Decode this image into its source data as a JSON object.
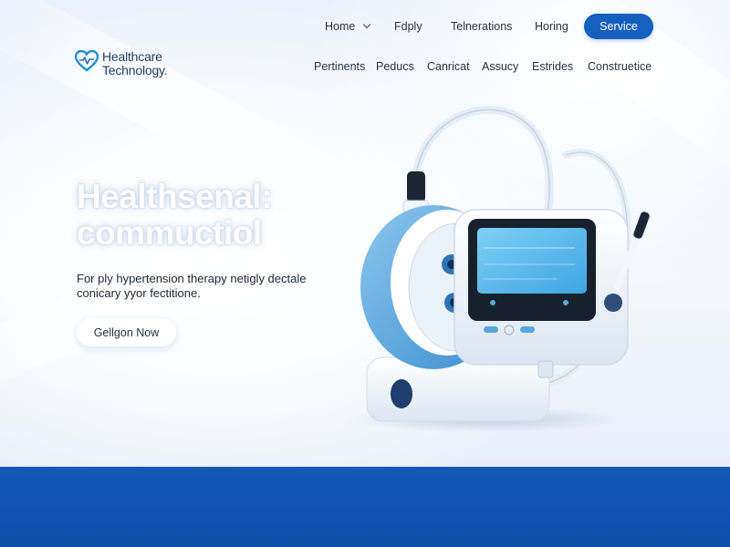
{
  "brand": {
    "line1": "Healthcare",
    "line2": "Technology."
  },
  "nav": {
    "top": [
      {
        "label": "Home"
      },
      {
        "label": "Fdply"
      },
      {
        "label": "Telnerations"
      },
      {
        "label": "Horing"
      }
    ],
    "service_button": "Service",
    "bottom": [
      {
        "label": "Pertinents"
      },
      {
        "label": "Peducs"
      },
      {
        "label": "Canricat"
      },
      {
        "label": "Assucy"
      },
      {
        "label": "Estrides"
      },
      {
        "label": "Construetice"
      }
    ]
  },
  "hero": {
    "headline_line1": "Healthsenal:",
    "headline_line2": "commuctiol",
    "subtext_line1": "For ply hypertension therapy netigly dectale",
    "subtext_line2": "conicary yyor fectitione.",
    "cta_label": "Gellgon Now"
  },
  "colors": {
    "brand_blue": "#1560bd",
    "footer_blue": "#0d4ea9",
    "device_accent": "#5aa6dd"
  },
  "icons": {
    "logo": "heart-pulse-icon",
    "nav_dropdown": "chevron-down-icon"
  }
}
